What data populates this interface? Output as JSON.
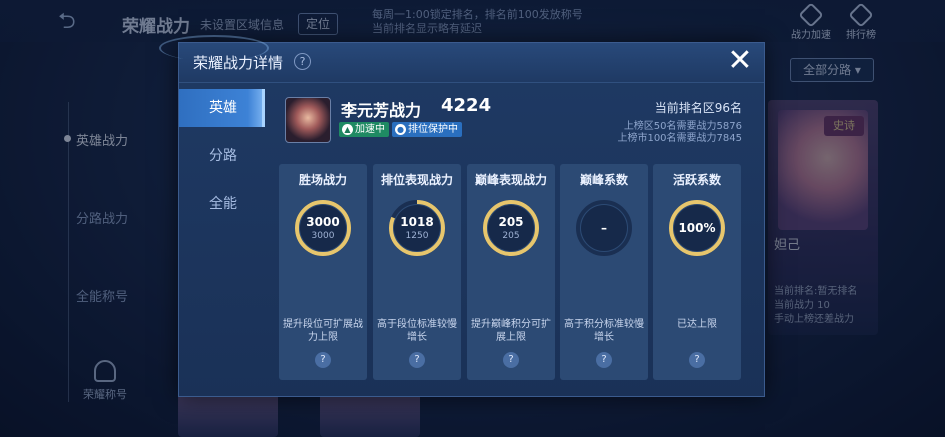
{
  "background": {
    "title": "荣耀战力",
    "region_text": "未设置区域信息",
    "locate_button": "定位",
    "notice_line1": "每周一1:00锁定排名，排名前100发放称号",
    "notice_line2": "当前排名显示略有延迟",
    "top_icons": [
      {
        "label": "战力加速",
        "icon": "boost-icon"
      },
      {
        "label": "排行榜",
        "icon": "leaderboard-icon"
      }
    ],
    "filter_label": "全部分路 ▾",
    "side_items": [
      "英雄战力",
      "分路战力",
      "全能称号"
    ],
    "side_badge": "荣耀称号",
    "card": {
      "tag": "史诗",
      "name": "妲己",
      "lines": [
        "当前排名:暂无排名",
        "当前战力 10",
        "手动上榜还差战力"
      ]
    }
  },
  "dialog": {
    "title": "荣耀战力详情",
    "help_icon": "?",
    "close_icon": "✕",
    "tabs": [
      {
        "label": "英雄",
        "active": true
      },
      {
        "label": "分路",
        "active": false
      },
      {
        "label": "全能",
        "active": false
      }
    ],
    "hero": {
      "name": "李元芳战力",
      "score": "4224",
      "badge_boost": "加速中",
      "badge_protect": "排位保护中",
      "rank_label": "当前排名区96名",
      "rank_line1": "上榜区50名需要战力5876",
      "rank_line2": "上榜市100名需要战力7845"
    },
    "stats": [
      {
        "title": "胜场战力",
        "value": "3000",
        "sub": "3000",
        "fill": 1.0,
        "desc": "提升段位可扩展战力上限"
      },
      {
        "title": "排位表现战力",
        "value": "1018",
        "sub": "1250",
        "fill": 0.814,
        "desc": "高于段位标准较慢增长"
      },
      {
        "title": "巅峰表现战力",
        "value": "205",
        "sub": "205",
        "fill": 1.0,
        "desc": "提升巅峰积分可扩展上限"
      },
      {
        "title": "巅峰系数",
        "value": "–",
        "sub": "",
        "fill": 0.0,
        "desc": "高于积分标准较慢增长"
      },
      {
        "title": "活跃系数",
        "value": "100%",
        "sub": "",
        "fill": 1.0,
        "desc": "已达上限"
      }
    ],
    "colors": {
      "ring_gold": "#e7c66d",
      "ring_track": "#1a2f52",
      "accent_blue": "#3d82d6"
    }
  }
}
